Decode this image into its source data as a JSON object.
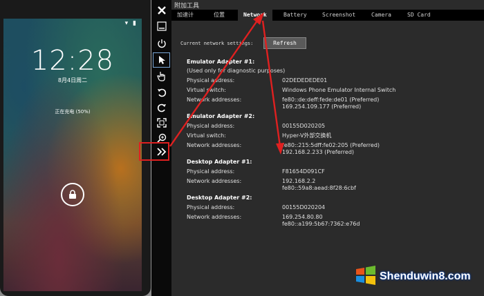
{
  "phone": {
    "status_icons": "▾ ▮",
    "clock": "12:28",
    "date": "8月4日周二",
    "charging": "正在充电 (50%)"
  },
  "toolbar": {
    "icons": [
      "close-icon",
      "minimize-icon",
      "power-icon",
      "pointer-icon",
      "touch-icon",
      "rotate-left-icon",
      "rotate-right-icon",
      "fit-screen-icon",
      "zoom-icon",
      "more-tools-icon"
    ]
  },
  "tools": {
    "title": "附加工具",
    "tabs": [
      {
        "label": "加速计"
      },
      {
        "label": "位置"
      },
      {
        "label": "Network"
      },
      {
        "label": "Battery"
      },
      {
        "label": "Screenshot"
      },
      {
        "label": "Camera"
      },
      {
        "label": "SD Card"
      }
    ],
    "active_tab": "Network",
    "current_label": "Current network settings:",
    "refresh_label": "Refresh",
    "adapters": [
      {
        "heading": "Emulator Adapter #1:",
        "note": "(Used only for diagnostic purposes)",
        "physical_label": "Physical address:",
        "physical": "02DEDEDEDE01",
        "switch_label": "Virtual switch:",
        "switch": "Windows Phone Emulator Internal Switch",
        "net_label": "Network addresses:",
        "net1": "fe80::de:deff:fede:de01 (Preferred)",
        "net2": "169.254.109.177 (Preferred)"
      },
      {
        "heading": "Emulator Adapter #2:",
        "physical_label": "Physical address:",
        "physical": "00155D020205",
        "switch_label": "Virtual switch:",
        "switch": "Hyper-V外部交换机",
        "net_label": "Network addresses:",
        "net1": "fe80::215:5dff:fe02:205 (Preferred)",
        "net2": "192.168.2.233 (Preferred)"
      },
      {
        "heading": "Desktop Adapter #1:",
        "physical_label": "Physical address:",
        "physical": "F81654D091CF",
        "net_label": "Network addresses:",
        "net1": "192.168.2.2",
        "net2": "fe80::59a8:aead:8f28:6cbf"
      },
      {
        "heading": "Desktop Adapter #2:",
        "physical_label": "Physical address:",
        "physical": "00155D020204",
        "net_label": "Network addresses:",
        "net1": "169.254.80.80",
        "net2": "fe80::a199:5b67:7362:e76d"
      }
    ]
  },
  "watermark": {
    "text": "Shenduwin8.com"
  },
  "colors": {
    "annotation": "#e02020",
    "panel": "#2b2b2b",
    "tab_bar": "#000000"
  }
}
